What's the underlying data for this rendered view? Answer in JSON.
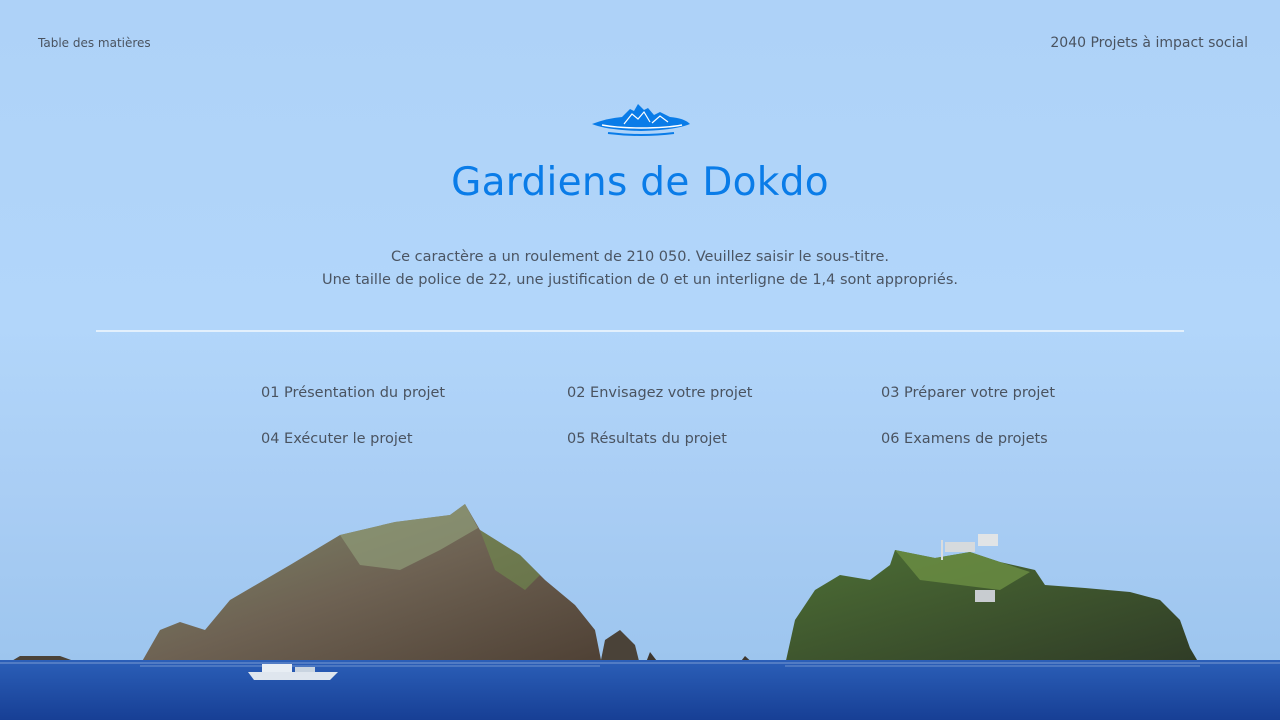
{
  "header": {
    "left_label": "Table des matières",
    "right_label": "2040 Projets à impact social"
  },
  "title": "Gardiens de Dokdo",
  "subtitle": {
    "line1": "Ce caractère a un roulement de 210 050. Veuillez saisir le sous-titre.",
    "line2": "Une taille de police de 22, une justification de 0 et un interligne de 1,4 sont appropriés."
  },
  "toc": {
    "items": [
      {
        "label": "01 Présentation du projet"
      },
      {
        "label": "02 Envisagez votre projet"
      },
      {
        "label": "03 Préparer votre projet"
      },
      {
        "label": "04 Exécuter le projet"
      },
      {
        "label": "05 Résultats du projet"
      },
      {
        "label": "06 Examens de projets"
      }
    ]
  },
  "colors": {
    "accent": "#0a7ce8",
    "text": "#4a5360",
    "sky": "#b2d6fa",
    "sea": "#1f4fa8"
  },
  "icons": {
    "logo": "island-mountain-icon"
  }
}
